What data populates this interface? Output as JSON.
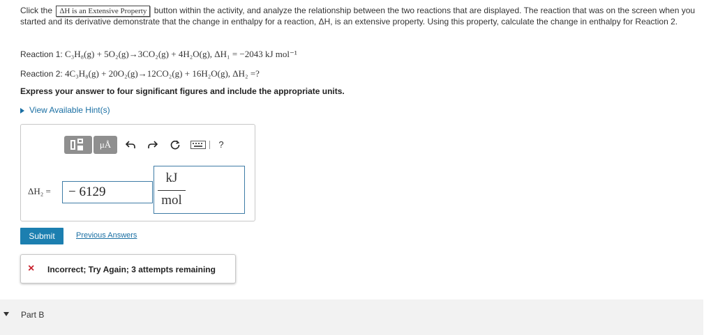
{
  "intro": {
    "prefix": "Click the",
    "button_label": "ΔH is an Extensive Property",
    "suffix": "button within the activity, and analyze the relationship between the two reactions that are displayed. The reaction that was on the screen when you started and its derivative demonstrate that the change in enthalpy for a reaction, ΔH, is an extensive property. Using this property, calculate the change in enthalpy for Reaction 2."
  },
  "reactions": [
    {
      "label": "Reaction 1:",
      "equation": "C₃H₈(g) + 5O₂(g)→3CO₂(g) + 4H₂O(g), ΔH₁ = −2043 kJ mol⁻¹"
    },
    {
      "label": "Reaction 2:",
      "equation": "4C₃H₈(g) + 20O₂(g)→12CO₂(g) + 16H₂O(g), ΔH₂ =?"
    }
  ],
  "prompt": "Express your answer to four significant figures and include the appropriate units.",
  "hints_link": "View Available Hint(s)",
  "toolbar": {
    "templates_icon": "templates-icon",
    "units_label": "μÅ",
    "undo_icon": "undo-icon",
    "redo_icon": "redo-icon",
    "reset_icon": "reset-icon",
    "keyboard_icon": "keyboard-icon",
    "help_label": "?"
  },
  "answer": {
    "lhs": "ΔH₂ =",
    "value": "− 6129",
    "unit_numerator": "kJ",
    "unit_denominator": "mol"
  },
  "submit_label": "Submit",
  "previous_answers_label": "Previous Answers",
  "feedback": {
    "icon": "×",
    "message": "Incorrect; Try Again; 3 attempts remaining",
    "color": "#c8202c"
  },
  "part_b": {
    "label": "Part B"
  }
}
